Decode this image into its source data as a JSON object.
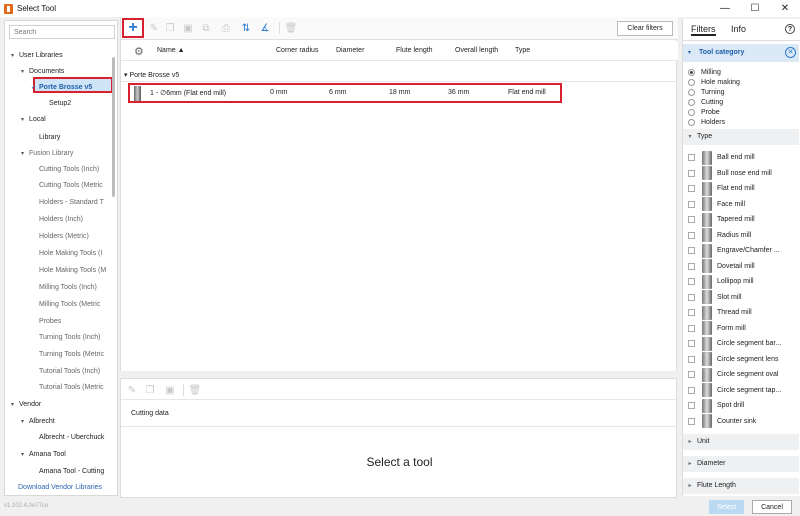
{
  "window": {
    "title": "Select Tool",
    "min": "—",
    "max": "☐",
    "close": "✕"
  },
  "left_panel": {
    "search_placeholder": "Search",
    "tree": [
      {
        "label": "User Libraries",
        "level": 0,
        "caret": "▾",
        "bold": false
      },
      {
        "label": "Documents",
        "level": 1,
        "caret": "▾",
        "bold": false
      },
      {
        "label": "Porte Brosse v5",
        "level": 2,
        "caret": "✓",
        "bold": true,
        "selected": true
      },
      {
        "label": "Setup2",
        "level": 3,
        "caret": "",
        "bold": false
      },
      {
        "label": "Local",
        "level": 1,
        "caret": "▾",
        "bold": false
      },
      {
        "label": "Library",
        "level": 2,
        "caret": "",
        "bold": false
      },
      {
        "label": "Fusion Library",
        "level": 1,
        "caret": "▾",
        "bold": false,
        "dim": true
      },
      {
        "label": "Cutting Tools (Inch)",
        "level": 2,
        "dim": true
      },
      {
        "label": "Cutting Tools (Metric",
        "level": 2,
        "dim": true
      },
      {
        "label": "Holders - Standard T",
        "level": 2,
        "dim": true
      },
      {
        "label": "Holders (Inch)",
        "level": 2,
        "dim": true
      },
      {
        "label": "Holders (Metric)",
        "level": 2,
        "dim": true
      },
      {
        "label": "Hole Making Tools (I",
        "level": 2,
        "dim": true
      },
      {
        "label": "Hole Making Tools (M",
        "level": 2,
        "dim": true
      },
      {
        "label": "Milling Tools (Inch)",
        "level": 2,
        "dim": true
      },
      {
        "label": "Milling Tools (Metric",
        "level": 2,
        "dim": true
      },
      {
        "label": "Probes",
        "level": 2,
        "dim": true
      },
      {
        "label": "Turning Tools (Inch)",
        "level": 2,
        "dim": true
      },
      {
        "label": "Turning Tools (Metric",
        "level": 2,
        "dim": true
      },
      {
        "label": "Tutorial Tools (Inch)",
        "level": 2,
        "dim": true
      },
      {
        "label": "Tutorial Tools (Metric",
        "level": 2,
        "dim": true
      },
      {
        "label": "Vendor",
        "level": 0,
        "caret": "▾"
      },
      {
        "label": "Albrecht",
        "level": 1,
        "caret": "▾"
      },
      {
        "label": "Albrecht - Uberchuck",
        "level": 2
      },
      {
        "label": "Amana Tool",
        "level": 1,
        "caret": "▾"
      },
      {
        "label": "Amana Tool - Cutting",
        "level": 2
      }
    ],
    "download_link": "Download Vendor Libraries",
    "version": "v1.102.4.0e77ce"
  },
  "toolbar": {
    "add_icon": "+",
    "clear_filters": "Clear filters"
  },
  "table": {
    "columns": [
      "Name ▲",
      "Corner radius",
      "Diameter",
      "Flute length",
      "Overall length",
      "Type"
    ],
    "group": "Porte Brosse v5",
    "group_caret": "▾",
    "rows": [
      {
        "name": "1 - ∅6mm (Flat end mill)",
        "corner_radius": "0 mm",
        "diameter": "6 mm",
        "flute_length": "18 mm",
        "overall_length": "36 mm",
        "type": "Flat end mill"
      }
    ]
  },
  "detail": {
    "cutting_data": "Cutting data",
    "empty_message": "Select a tool"
  },
  "right_panel": {
    "tab_filters": "Filters",
    "tab_info": "Info",
    "help": "?",
    "tool_category_label": "Tool category",
    "categories": [
      {
        "label": "Milling",
        "checked": true
      },
      {
        "label": "Hole making",
        "checked": false
      },
      {
        "label": "Turning",
        "checked": false
      },
      {
        "label": "Cutting",
        "checked": false
      },
      {
        "label": "Probe",
        "checked": false
      },
      {
        "label": "Holders",
        "checked": false
      }
    ],
    "type_label": "Type",
    "types": [
      "Ball end mill",
      "Bull nose end mill",
      "Flat end mill",
      "Face mill",
      "Tapered mill",
      "Radius mill",
      "Engrave/Chamfer ...",
      "Dovetail mill",
      "Lollipop mill",
      "Slot mill",
      "Thread mill",
      "Form mill",
      "Circle segment bar...",
      "Circle segment lens",
      "Circle segment oval",
      "Circle segment tap...",
      "Spot drill",
      "Counter sink"
    ],
    "unit_label": "Unit",
    "diameter_label": "Diameter",
    "flute_length_label": "Flute Length"
  },
  "footer": {
    "select": "Select",
    "cancel": "Cancel"
  }
}
